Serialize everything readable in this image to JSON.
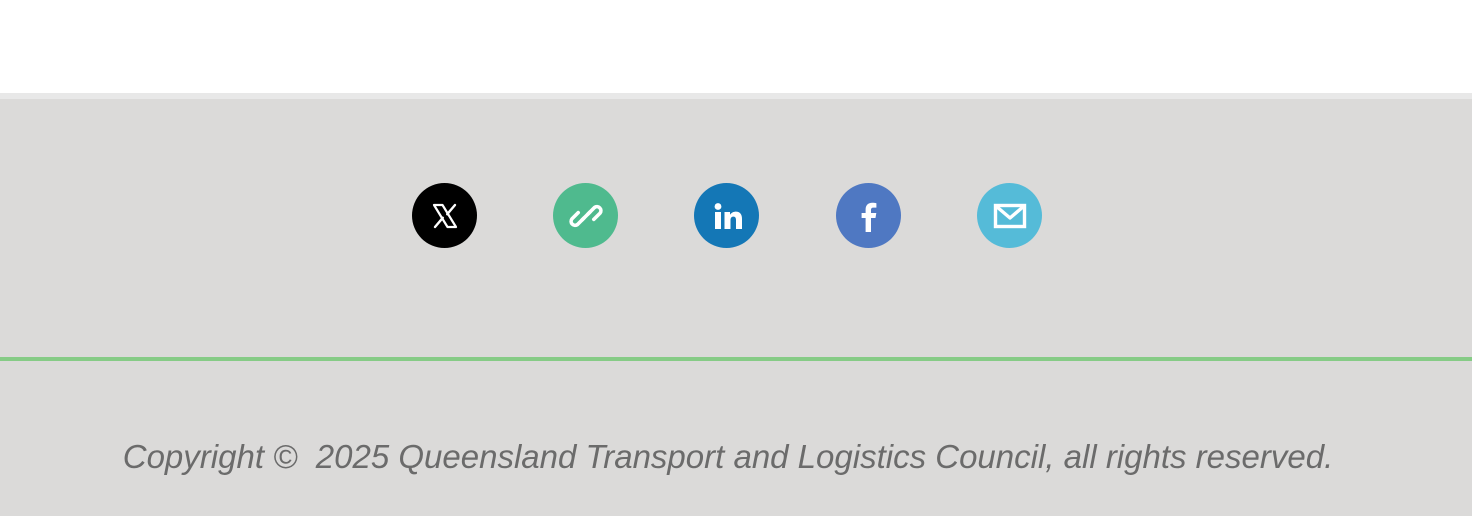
{
  "footer": {
    "social_links": [
      {
        "name": "x-twitter",
        "icon": "x-logo-icon",
        "bg": "#000000"
      },
      {
        "name": "website-link",
        "icon": "link-icon",
        "bg": "#4fba8e"
      },
      {
        "name": "linkedin",
        "icon": "linkedin-icon",
        "bg": "#1477b6"
      },
      {
        "name": "facebook",
        "icon": "facebook-icon",
        "bg": "#4f78c2"
      },
      {
        "name": "email",
        "icon": "envelope-icon",
        "bg": "#55bbd8"
      }
    ],
    "divider_color": "#86cb86",
    "background": "#dbdad9",
    "copyright": "Copyright ©  2025 Queensland Transport and Logistics Council, all rights reserved."
  }
}
